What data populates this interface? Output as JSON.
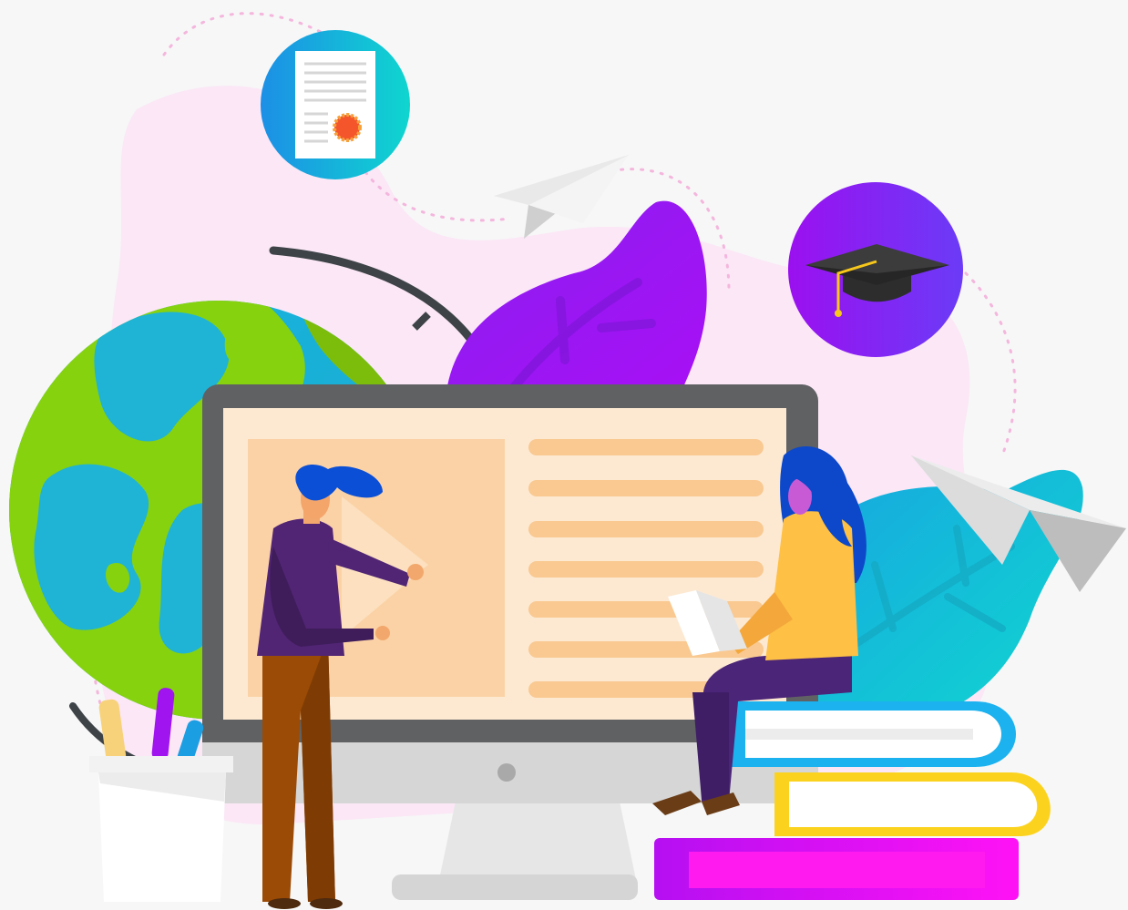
{
  "illustration": {
    "colors": {
      "background": "#f7f7f7",
      "blob": "#fbe7f6",
      "globe_ocean": "#22b8d8",
      "globe_land": "#7fd10f",
      "purple_leaf": "#9b13f2",
      "teal_leaf": "#12c9d6",
      "monitor_frame": "#5f5f5f",
      "screen": "#fde9d2",
      "screen_panel": "#fbd2a6",
      "screen_lines": "#f9c991",
      "man_shirt": "#512574",
      "man_pants": "#9a4a04",
      "man_hair": "#0b4fd6",
      "woman_shirt": "#fec045",
      "woman_pants": "#4b2577",
      "woman_hair": "#0c48c9",
      "book_blue": "#1bb2ef",
      "book_yellow": "#fbd31e",
      "book_magenta": "#f00ffa",
      "certificate_circle": "#16b6dd",
      "cap_circle": "#8e1ff6"
    },
    "icons": [
      "certificate-icon",
      "graduation-cap-icon",
      "paper-plane-icon",
      "globe-icon",
      "desktop-monitor-icon",
      "laptop-icon",
      "pencil-cup-icon",
      "book-stack-icon"
    ]
  }
}
